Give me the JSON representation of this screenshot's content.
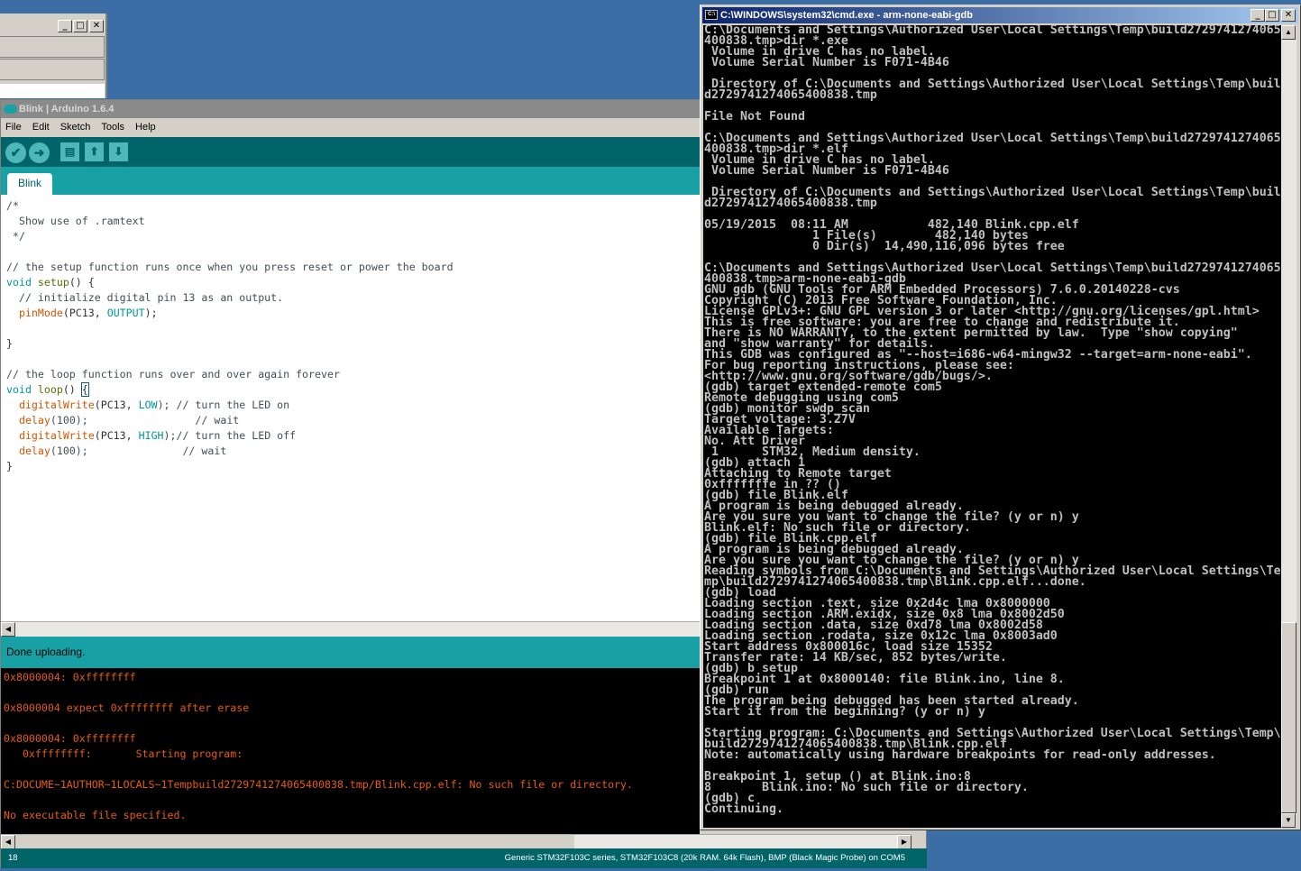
{
  "back_window": {
    "buttons": [
      "minimize",
      "maximize",
      "close"
    ]
  },
  "arduino": {
    "title": "Blink | Arduino 1.6.4",
    "menu": [
      "File",
      "Edit",
      "Sketch",
      "Tools",
      "Help"
    ],
    "toolbar": [
      {
        "icon": "verify-check-icon",
        "glyph": "✔"
      },
      {
        "icon": "upload-arrow-icon",
        "glyph": "➜"
      },
      {
        "icon": "new-file-icon",
        "glyph": "▤"
      },
      {
        "icon": "open-up-arrow-icon",
        "glyph": "⬆"
      },
      {
        "icon": "save-down-arrow-icon",
        "glyph": "⬇"
      }
    ],
    "tab": "Blink",
    "code": {
      "l1": "/*",
      "l2": "  Show use of .ramtext",
      "l3": " */",
      "l5": "// the setup function runs once when you press reset or power the board",
      "void": "void",
      "setup": "setup",
      "setup_rest": "() {",
      "l7": "  // initialize digital pin 13 as an output.",
      "pinMode": "pinMode",
      "pc13a": "(PC13, ",
      "OUTPUT": "OUTPUT",
      "end1": ");",
      "close": "}",
      "l12": "// the loop function runs over and over again forever",
      "loop": "loop",
      "loop_rest": "() ",
      "brace": "{",
      "dw": "digitalWrite",
      "pc13": "(PC13, ",
      "LOW": "LOW",
      "c_on": "); // turn the LED on",
      "delay": "delay",
      "d1": "(100);                 // wait",
      "HIGH": "HIGH",
      "c_off": ");// turn the LED off",
      "d2": "(100);               // wait"
    },
    "status": "Done uploading.",
    "console": [
      "0x8000004: 0xffffffff",
      "",
      "0x8000004 expect 0xffffffff after erase",
      "",
      "0x8000004: 0xffffffff",
      "   0xffffffff:       Starting program:",
      "",
      "C:DOCUME~1AUTHOR~1LOCALS~1Tempbuild2729741274065400838.tmp/Blink.cpp.elf: No such file or directory.",
      "",
      "No executable file specified."
    ],
    "line_number": "18",
    "board": "Generic STM32F103C series, STM32F103C8 (20k RAM. 64k Flash), BMP (Black Magic Probe) on COM5",
    "colors": {
      "teal_dark": "#006468",
      "teal": "#17a1a5",
      "console_text": "#e55d0a"
    }
  },
  "cmd": {
    "title": "C:\\WINDOWS\\system32\\cmd.exe - arm-none-eabi-gdb",
    "lines": [
      "C:\\Documents and Settings\\Authorized User\\Local Settings\\Temp\\build2729741274065",
      "400838.tmp>dir *.exe",
      " Volume in drive C has no label.",
      " Volume Serial Number is F071-4B46",
      "",
      " Directory of C:\\Documents and Settings\\Authorized User\\Local Settings\\Temp\\buil",
      "d2729741274065400838.tmp",
      "",
      "File Not Found",
      "",
      "C:\\Documents and Settings\\Authorized User\\Local Settings\\Temp\\build2729741274065",
      "400838.tmp>dir *.elf",
      " Volume in drive C has no label.",
      " Volume Serial Number is F071-4B46",
      "",
      " Directory of C:\\Documents and Settings\\Authorized User\\Local Settings\\Temp\\buil",
      "d2729741274065400838.tmp",
      "",
      "05/19/2015  08:11 AM           482,140 Blink.cpp.elf",
      "               1 File(s)        482,140 bytes",
      "               0 Dir(s)  14,490,116,096 bytes free",
      "",
      "C:\\Documents and Settings\\Authorized User\\Local Settings\\Temp\\build2729741274065",
      "400838.tmp>arm-none-eabi-gdb",
      "GNU gdb (GNU Tools for ARM Embedded Processors) 7.6.0.20140228-cvs",
      "Copyright (C) 2013 Free Software Foundation, Inc.",
      "License GPLv3+: GNU GPL version 3 or later <http://gnu.org/licenses/gpl.html>",
      "This is free software: you are free to change and redistribute it.",
      "There is NO WARRANTY, to the extent permitted by law.  Type \"show copying\"",
      "and \"show warranty\" for details.",
      "This GDB was configured as \"--host=i686-w64-mingw32 --target=arm-none-eabi\".",
      "For bug reporting instructions, please see:",
      "<http://www.gnu.org/software/gdb/bugs/>.",
      "(gdb) target extended-remote com5",
      "Remote debugging using com5",
      "(gdb) monitor swdp_scan",
      "Target voltage: 3.27V",
      "Available Targets:",
      "No. Att Driver",
      " 1      STM32, Medium density.",
      "(gdb) attach 1",
      "Attaching to Remote target",
      "0xfffffffe in ?? ()",
      "(gdb) file Blink.elf",
      "A program is being debugged already.",
      "Are you sure you want to change the file? (y or n) y",
      "Blink.elf: No such file or directory.",
      "(gdb) file Blink.cpp.elf",
      "A program is being debugged already.",
      "Are you sure you want to change the file? (y or n) y",
      "Reading symbols from C:\\Documents and Settings\\Authorized User\\Local Settings\\Te",
      "mp\\build2729741274065400838.tmp\\Blink.cpp.elf...done.",
      "(gdb) load",
      "Loading section .text, size 0x2d4c lma 0x8000000",
      "Loading section .ARM.exidx, size 0x8 lma 0x8002d50",
      "Loading section .data, size 0xd78 lma 0x8002d58",
      "Loading section .rodata, size 0x12c lma 0x8003ad0",
      "Start address 0x800016c, load size 15352",
      "Transfer rate: 14 KB/sec, 852 bytes/write.",
      "(gdb) b setup",
      "Breakpoint 1 at 0x8000140: file Blink.ino, line 8.",
      "(gdb) run",
      "The program being debugged has been started already.",
      "Start it from the beginning? (y or n) y",
      "",
      "Starting program: C:\\Documents and Settings\\Authorized User\\Local Settings\\Temp\\",
      "build2729741274065400838.tmp\\Blink.cpp.elf",
      "Note: automatically using hardware breakpoints for read-only addresses.",
      "",
      "Breakpoint 1, setup () at Blink.ino:8",
      "8       Blink.ino: No such file or directory.",
      "(gdb) c",
      "Continuing."
    ]
  }
}
